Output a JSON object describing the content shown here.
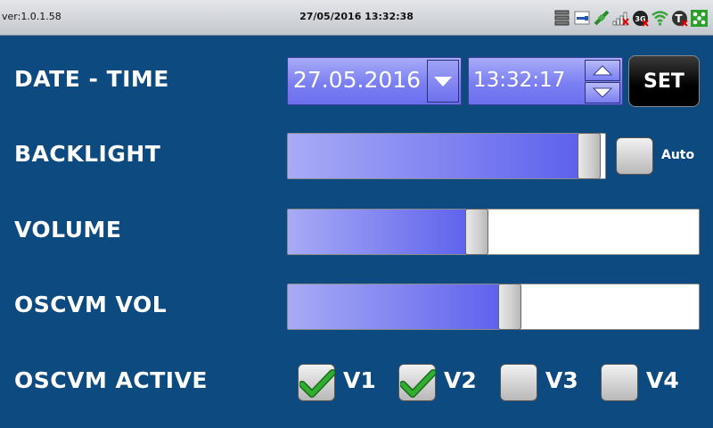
{
  "status_bar": {
    "version": "ver:1.0.1.58",
    "datetime": "27/05/2016 13:32:38",
    "icons": [
      "storage-icon",
      "usb-icon",
      "satellite-icon",
      "signal-icon",
      "3g-icon",
      "wifi-icon",
      "tx-icon",
      "network-icon"
    ]
  },
  "rows": {
    "date_time": {
      "label": "DATE - TIME",
      "date_value": "27.05.2016",
      "time_value": "13:32:17",
      "set_label": "SET"
    },
    "backlight": {
      "label": "BACKLIGHT",
      "level": 0.95,
      "auto_label": "Auto",
      "auto_checked": false
    },
    "volume": {
      "label": "VOLUME",
      "level": 0.46
    },
    "oscvm_vol": {
      "label": "OSCVM VOL",
      "level": 0.54
    },
    "oscvm_active": {
      "label": "OSCVM ACTIVE",
      "options": [
        {
          "label": "V1",
          "checked": true
        },
        {
          "label": "V2",
          "checked": true
        },
        {
          "label": "V3",
          "checked": false
        },
        {
          "label": "V4",
          "checked": false
        }
      ]
    }
  },
  "colors": {
    "background": "#0d4a80",
    "field_fill": "#7b7ff2",
    "check_green": "#2fae2f"
  }
}
